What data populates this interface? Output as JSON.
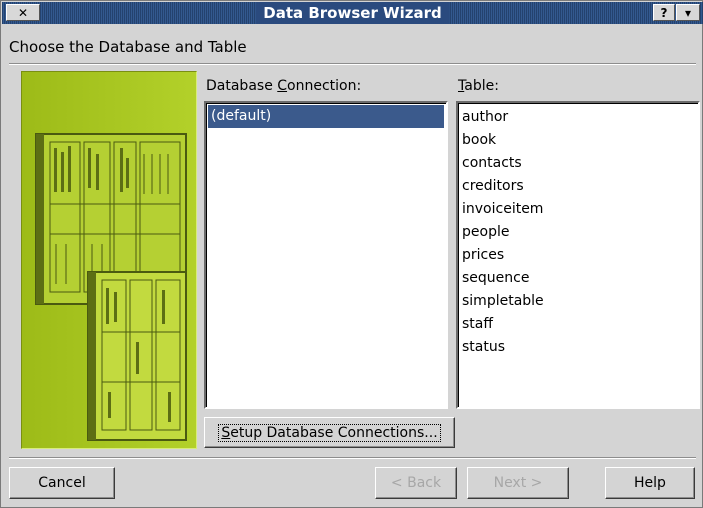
{
  "window": {
    "title": "Data Browser Wizard",
    "close_glyph": "✕",
    "help_glyph": "?",
    "menu_glyph": "▾"
  },
  "page": {
    "heading": "Choose the Database and Table"
  },
  "connection": {
    "label_pre": "Database ",
    "label_mnemonic": "C",
    "label_post": "onnection:",
    "items": [
      "(default)"
    ]
  },
  "table": {
    "label_mnemonic": "T",
    "label_post": "able:",
    "items": [
      "author",
      "book",
      "contacts",
      "creditors",
      "invoiceitem",
      "people",
      "prices",
      "sequence",
      "simpletable",
      "staff",
      "status"
    ]
  },
  "buttons": {
    "setup_mnemonic": "S",
    "setup_rest": "etup Database Connections...",
    "cancel": "Cancel",
    "back": "< Back",
    "next": "Next >",
    "help": "Help"
  },
  "colors": {
    "titlebar": "#2e4f82",
    "selection": "#3b5a8c",
    "illustration_bg": "#a9c91d"
  }
}
